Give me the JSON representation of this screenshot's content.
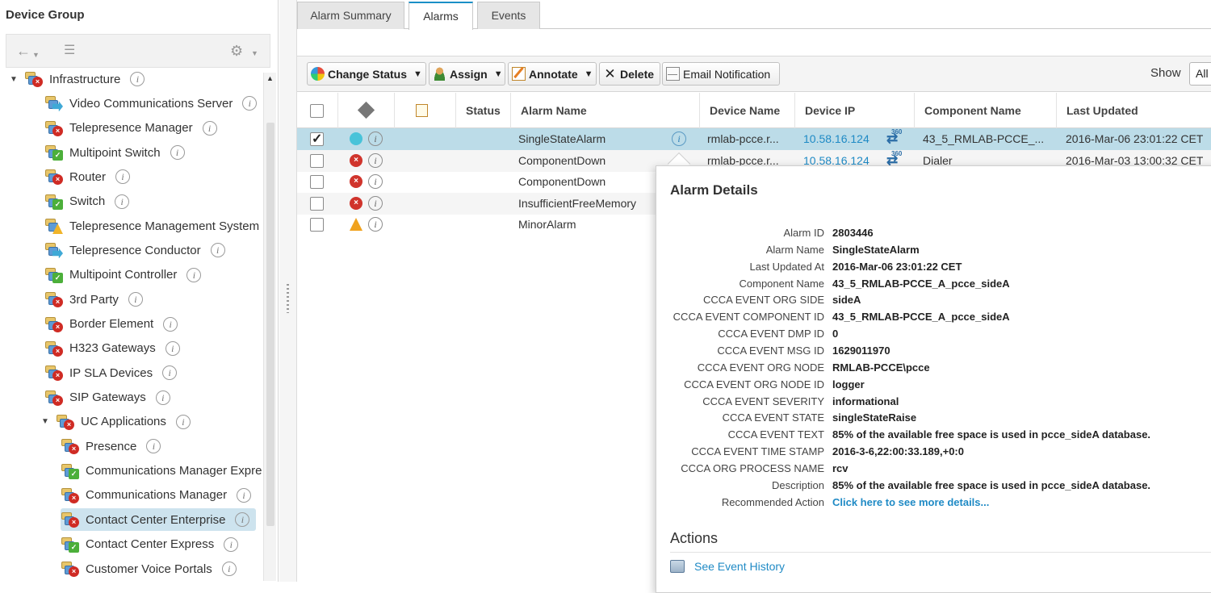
{
  "left_panel": {
    "title": "Device Group",
    "tree": [
      {
        "label": "Infrastructure",
        "level": 0,
        "expanded": true,
        "status": "critical"
      },
      {
        "label": "Video Communications Server",
        "level": 1,
        "status": "transfer"
      },
      {
        "label": "Telepresence Manager",
        "level": 1,
        "status": "critical"
      },
      {
        "label": "Multipoint Switch",
        "level": 1,
        "status": "ok"
      },
      {
        "label": "Router",
        "level": 1,
        "status": "critical"
      },
      {
        "label": "Switch",
        "level": 1,
        "status": "ok"
      },
      {
        "label": "Telepresence Management System",
        "level": 1,
        "status": "warning"
      },
      {
        "label": "Telepresence Conductor",
        "level": 1,
        "status": "transfer"
      },
      {
        "label": "Multipoint Controller",
        "level": 1,
        "status": "ok"
      },
      {
        "label": "3rd Party",
        "level": 1,
        "status": "critical"
      },
      {
        "label": "Border Element",
        "level": 1,
        "status": "critical"
      },
      {
        "label": "H323 Gateways",
        "level": 1,
        "status": "critical"
      },
      {
        "label": "IP SLA Devices",
        "level": 1,
        "status": "critical"
      },
      {
        "label": "SIP Gateways",
        "level": 1,
        "status": "critical"
      },
      {
        "label": "UC Applications",
        "level": 1,
        "expanded": true,
        "status": "critical"
      },
      {
        "label": "Presence",
        "level": 2,
        "status": "critical"
      },
      {
        "label": "Communications Manager Expre",
        "level": 2,
        "status": "ok"
      },
      {
        "label": "Communications Manager",
        "level": 2,
        "status": "critical"
      },
      {
        "label": "Contact Center Enterprise",
        "level": 2,
        "status": "critical",
        "selected": true
      },
      {
        "label": "Contact Center Express",
        "level": 2,
        "status": "ok"
      },
      {
        "label": "Customer Voice Portals",
        "level": 2,
        "status": "critical"
      }
    ]
  },
  "tabs": [
    {
      "label": "Alarm Summary",
      "active": false
    },
    {
      "label": "Alarms",
      "active": true
    },
    {
      "label": "Events",
      "active": false
    }
  ],
  "toolbar": {
    "change_status": "Change Status",
    "assign": "Assign",
    "annotate": "Annotate",
    "delete": "Delete",
    "email_notification": "Email Notification",
    "show_label": "Show",
    "show_value": "All"
  },
  "grid": {
    "headers": [
      "Status",
      "Alarm Name",
      "Device Name",
      "Device IP",
      "Component Name",
      "Last Updated"
    ],
    "rows": [
      {
        "checked": true,
        "severity": "info",
        "alarm_name": "SingleStateAlarm",
        "device_name": "rmlab-pcce.r...",
        "device_ip": "10.58.16.124",
        "component_name": "43_5_RMLAB-PCCE_...",
        "last_updated": "2016-Mar-06 23:01:22 CET"
      },
      {
        "checked": false,
        "severity": "critical",
        "alarm_name": "ComponentDown",
        "device_name": "rmlab-pcce.r...",
        "device_ip": "10.58.16.124",
        "component_name": "Dialer",
        "last_updated": "2016-Mar-03 13:00:32 CET"
      },
      {
        "checked": false,
        "severity": "critical",
        "alarm_name": "ComponentDown",
        "device_name": "",
        "device_ip": "",
        "component_name": "",
        "last_updated": ""
      },
      {
        "checked": false,
        "severity": "critical",
        "alarm_name": "InsufficientFreeMemory",
        "device_name": "",
        "device_ip": "",
        "component_name": "",
        "last_updated": ""
      },
      {
        "checked": false,
        "severity": "warning",
        "alarm_name": "MinorAlarm",
        "device_name": "",
        "device_ip": "",
        "component_name": "",
        "last_updated": ""
      }
    ],
    "sync_badge": "360"
  },
  "alarm_details": {
    "title": "Alarm Details",
    "fields": [
      {
        "label": "Alarm ID",
        "value": "2803446"
      },
      {
        "label": "Alarm Name",
        "value": "SingleStateAlarm"
      },
      {
        "label": "Last Updated At",
        "value": "2016-Mar-06 23:01:22 CET"
      },
      {
        "label": "Component Name",
        "value": "43_5_RMLAB-PCCE_A_pcce_sideA"
      },
      {
        "label": "CCCA EVENT ORG SIDE",
        "value": "sideA"
      },
      {
        "label": "CCCA EVENT COMPONENT ID",
        "value": "43_5_RMLAB-PCCE_A_pcce_sideA"
      },
      {
        "label": "CCCA EVENT DMP ID",
        "value": "0"
      },
      {
        "label": "CCCA EVENT MSG ID",
        "value": "1629011970"
      },
      {
        "label": "CCCA EVENT ORG NODE",
        "value": "RMLAB-PCCE\\pcce"
      },
      {
        "label": "CCCA EVENT ORG NODE ID",
        "value": "logger"
      },
      {
        "label": "CCCA EVENT SEVERITY",
        "value": "informational"
      },
      {
        "label": "CCCA EVENT STATE",
        "value": "singleStateRaise"
      },
      {
        "label": "CCCA EVENT TEXT",
        "value": "85% of the available free space is used in pcce_sideA database."
      },
      {
        "label": "CCCA EVENT TIME STAMP",
        "value": "2016-3-6,22:00:33.189,+0:0"
      },
      {
        "label": "CCCA ORG PROCESS NAME",
        "value": "rcv"
      },
      {
        "label": "Description",
        "value": "85% of the available free space is used in pcce_sideA database."
      },
      {
        "label": "Recommended Action",
        "value": "Click here to see more details...",
        "link": true
      }
    ],
    "actions_title": "Actions",
    "see_event_history": "See Event History"
  }
}
